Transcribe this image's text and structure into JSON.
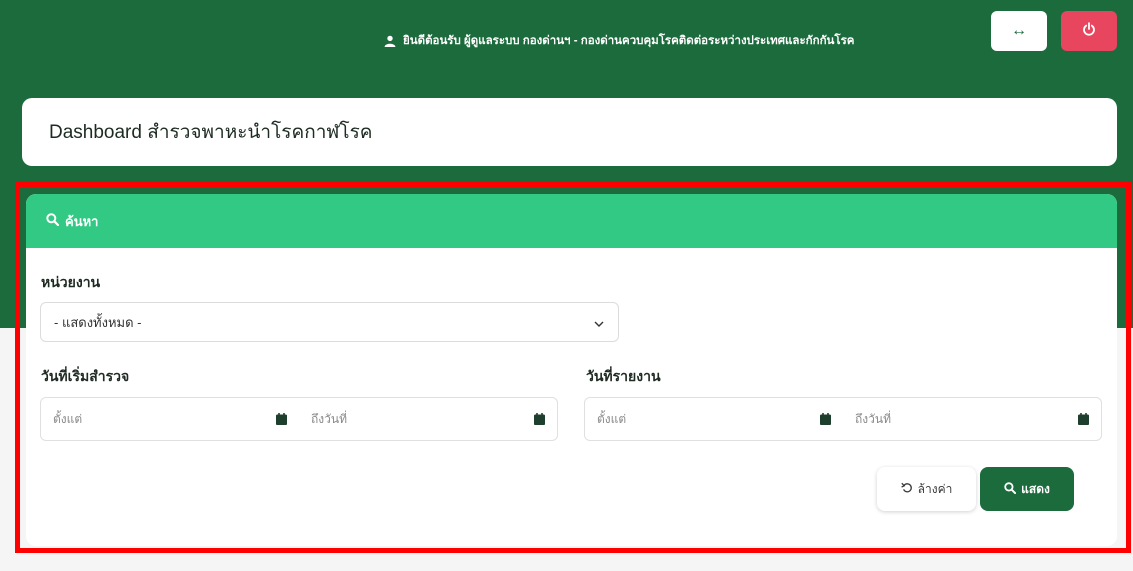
{
  "header": {
    "welcome_text": "ยินดีต้อนรับ ผู้ดูแลระบบ กองด่านฯ - กองด่านควบคุมโรคติดต่อระหว่างประเทศและกักกันโรค",
    "user_icon": "user-icon",
    "toggle_label": "↔",
    "power_icon": "power-icon"
  },
  "page": {
    "title": "Dashboard สำรวจพาหะนำโรคกาฬโรค"
  },
  "search": {
    "heading": "ค้นหา",
    "heading_icon": "search-icon",
    "unit_label": "หน่วยงาน",
    "unit_selected": "- แสดงทั้งหมด -",
    "survey_date_label": "วันที่เริ่มสำรวจ",
    "report_date_label": "วันที่รายงาน",
    "from_placeholder": "ตั้งแต่",
    "to_placeholder": "ถึงวันที่",
    "reset_label": "ล้างค่า",
    "show_label": "แสดง"
  },
  "colors": {
    "header_green": "#1c6b3c",
    "search_head_green": "#32c984",
    "power_red": "#e8455f",
    "highlight_red": "#ff0000"
  }
}
